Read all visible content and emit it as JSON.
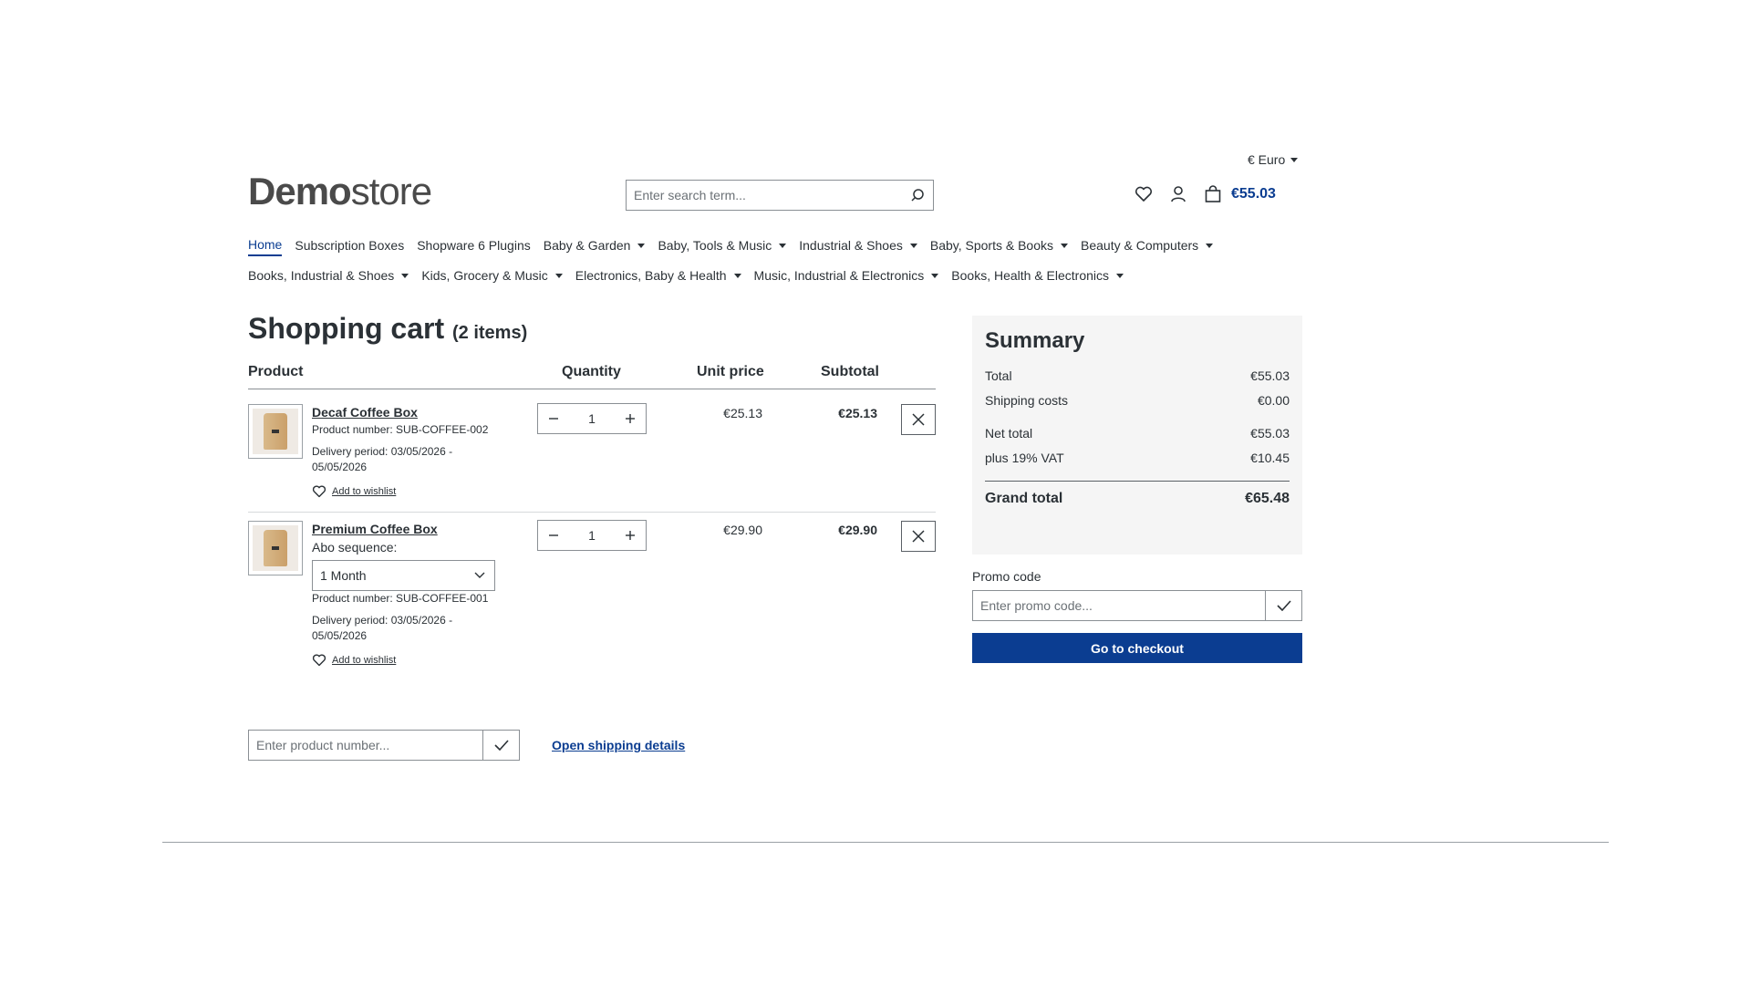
{
  "header": {
    "currency": "€ Euro",
    "logo_bold": "Demo",
    "logo_light": "store",
    "search_placeholder": "Enter search term...",
    "cart_total": "€55.03"
  },
  "nav": {
    "row1": [
      {
        "label": "Home",
        "active": true,
        "dropdown": false
      },
      {
        "label": "Subscription Boxes",
        "dropdown": false
      },
      {
        "label": "Shopware 6 Plugins",
        "dropdown": false
      },
      {
        "label": "Baby & Garden",
        "dropdown": true
      },
      {
        "label": "Baby, Tools & Music",
        "dropdown": true
      },
      {
        "label": "Industrial & Shoes",
        "dropdown": true
      },
      {
        "label": "Baby, Sports & Books",
        "dropdown": true
      },
      {
        "label": "Beauty & Computers",
        "dropdown": true
      }
    ],
    "row2": [
      {
        "label": "Books, Industrial & Shoes",
        "dropdown": true
      },
      {
        "label": "Kids, Grocery & Music",
        "dropdown": true
      },
      {
        "label": "Electronics, Baby & Health",
        "dropdown": true
      },
      {
        "label": "Music, Industrial & Electronics",
        "dropdown": true
      },
      {
        "label": "Books, Health & Electronics",
        "dropdown": true
      }
    ]
  },
  "cart": {
    "title": "Shopping cart",
    "count": "(2 items)",
    "columns": {
      "product": "Product",
      "quantity": "Quantity",
      "unit_price": "Unit price",
      "subtotal": "Subtotal"
    },
    "items": [
      {
        "name": "Decaf Coffee Box",
        "product_number": "Product number: SUB-COFFEE-002",
        "delivery_line1": "Delivery period: 03/05/2026 -",
        "delivery_line2": "05/05/2026",
        "wishlist": "Add to wishlist",
        "quantity": "1",
        "unit_price": "€25.13",
        "subtotal": "€25.13"
      },
      {
        "name": "Premium Coffee Box",
        "abo_label": "Abo sequence:",
        "abo_value": "1 Month",
        "product_number": "Product number: SUB-COFFEE-001",
        "delivery_line1": "Delivery period: 03/05/2026 -",
        "delivery_line2": "05/05/2026",
        "wishlist": "Add to wishlist",
        "quantity": "1",
        "unit_price": "€29.90",
        "subtotal": "€29.90"
      }
    ],
    "product_number_placeholder": "Enter product number...",
    "shipping_link": "Open shipping details"
  },
  "summary": {
    "title": "Summary",
    "total_label": "Total",
    "total_value": "€55.03",
    "shipping_label": "Shipping costs",
    "shipping_value": "€0.00",
    "net_label": "Net total",
    "net_value": "€55.03",
    "vat_label": "plus 19% VAT",
    "vat_value": "€10.45",
    "grand_label": "Grand total",
    "grand_value": "€65.48",
    "promo_label": "Promo code",
    "promo_placeholder": "Enter promo code...",
    "checkout_label": "Go to checkout"
  },
  "colors": {
    "accent": "#0b3d91",
    "text": "#2b3136",
    "summary_bg": "#f5f5f5"
  }
}
